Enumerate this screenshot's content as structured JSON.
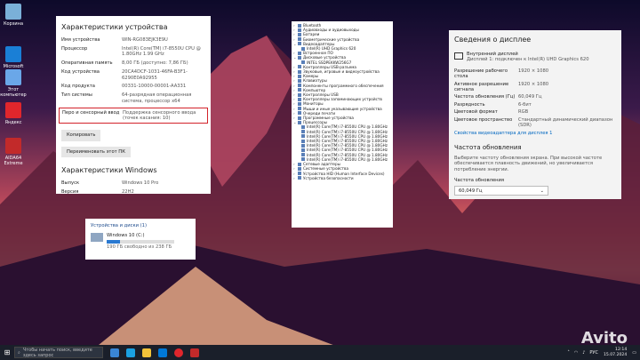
{
  "desktop": {
    "icons": [
      {
        "label": "Корзина",
        "color": "#7ab0d8"
      },
      {
        "label": "Microsoft Edge",
        "color": "#1a7fd6"
      },
      {
        "label": "Этот компьютер",
        "color": "#6aa7e8"
      },
      {
        "label": "Яндекс",
        "color": "#e0262c"
      },
      {
        "label": "AIDA64 Extreme",
        "color": "#c22a2a"
      }
    ]
  },
  "device_specs": {
    "title": "Характеристики устройства",
    "rows": [
      {
        "k": "Имя устройства",
        "v": "WIN-RG083EJK3E9U"
      },
      {
        "k": "Процессор",
        "v": "Intel(R) Core(TM) i7-8550U CPU @ 1.80GHz 1.99 GHz"
      },
      {
        "k": "Оперативная память",
        "v": "8,00 ГБ (доступно: 7,86 ГБ)"
      },
      {
        "k": "Код устройства",
        "v": "20CA4DCF-1031-46FA-B3F1-6290E0A92955"
      },
      {
        "k": "Код продукта",
        "v": "00331-10000-00001-AA331"
      },
      {
        "k": "Тип системы",
        "v": "64-разрядная операционная система, процессор x64"
      }
    ],
    "pen_row": {
      "k": "Перо и сенсорный ввод",
      "v": "Поддержка сенсорного ввода (точек касания: 10)"
    },
    "copy_button": "Копировать",
    "rename_button": "Переименовать этот ПК",
    "windows_title": "Характеристики Windows",
    "win_rows": [
      {
        "k": "Выпуск",
        "v": "Windows 10 Pro"
      },
      {
        "k": "Версия",
        "v": "22H2"
      }
    ]
  },
  "device_manager": {
    "items": [
      {
        "label": "Bluetooth",
        "level": 0,
        "arrow": "›"
      },
      {
        "label": "Аудиовходы и аудиовыходы",
        "level": 0,
        "arrow": "›"
      },
      {
        "label": "Батареи",
        "level": 0,
        "arrow": "›"
      },
      {
        "label": "Биометрические устройства",
        "level": 0,
        "arrow": "›"
      },
      {
        "label": "Видеоадаптеры",
        "level": 0,
        "arrow": "⌄"
      },
      {
        "label": "Intel(R) UHD Graphics 620",
        "level": 1,
        "arrow": ""
      },
      {
        "label": "Встроенное ПО",
        "level": 0,
        "arrow": "›"
      },
      {
        "label": "Дисковые устройства",
        "level": 0,
        "arrow": "⌄"
      },
      {
        "label": "INTEL SSDPEKKW256G7",
        "level": 1,
        "arrow": ""
      },
      {
        "label": "Контроллеры USB-разъема",
        "level": 0,
        "arrow": "›"
      },
      {
        "label": "Звуковые, игровые и видеоустройства",
        "level": 0,
        "arrow": "›"
      },
      {
        "label": "Камеры",
        "level": 0,
        "arrow": "›"
      },
      {
        "label": "Клавиатуры",
        "level": 0,
        "arrow": "›"
      },
      {
        "label": "Компоненты программного обеспечения",
        "level": 0,
        "arrow": "›"
      },
      {
        "label": "Компьютер",
        "level": 0,
        "arrow": "›"
      },
      {
        "label": "Контроллеры USB",
        "level": 0,
        "arrow": "›"
      },
      {
        "label": "Контроллеры запоминающих устройств",
        "level": 0,
        "arrow": "›"
      },
      {
        "label": "Мониторы",
        "level": 0,
        "arrow": "›"
      },
      {
        "label": "Мыши и иные указывающие устройства",
        "level": 0,
        "arrow": "›"
      },
      {
        "label": "Очереди печати",
        "level": 0,
        "arrow": "›"
      },
      {
        "label": "Программные устройства",
        "level": 0,
        "arrow": "›"
      },
      {
        "label": "Процессоры",
        "level": 0,
        "arrow": "⌄"
      },
      {
        "label": "Intel(R) Core(TM) i7-8550U CPU @ 1.80GHz",
        "level": 1,
        "arrow": ""
      },
      {
        "label": "Intel(R) Core(TM) i7-8550U CPU @ 1.80GHz",
        "level": 1,
        "arrow": ""
      },
      {
        "label": "Intel(R) Core(TM) i7-8550U CPU @ 1.80GHz",
        "level": 1,
        "arrow": ""
      },
      {
        "label": "Intel(R) Core(TM) i7-8550U CPU @ 1.80GHz",
        "level": 1,
        "arrow": ""
      },
      {
        "label": "Intel(R) Core(TM) i7-8550U CPU @ 1.80GHz",
        "level": 1,
        "arrow": ""
      },
      {
        "label": "Intel(R) Core(TM) i7-8550U CPU @ 1.80GHz",
        "level": 1,
        "arrow": ""
      },
      {
        "label": "Intel(R) Core(TM) i7-8550U CPU @ 1.80GHz",
        "level": 1,
        "arrow": ""
      },
      {
        "label": "Intel(R) Core(TM) i7-8550U CPU @ 1.80GHz",
        "level": 1,
        "arrow": ""
      },
      {
        "label": "Сетевые адаптеры",
        "level": 0,
        "arrow": "›"
      },
      {
        "label": "Системные устройства",
        "level": 0,
        "arrow": "›"
      },
      {
        "label": "Устройства HID (Human Interface Devices)",
        "level": 0,
        "arrow": "›"
      },
      {
        "label": "Устройства безопасности",
        "level": 0,
        "arrow": "›"
      }
    ]
  },
  "display_info": {
    "title": "Сведения о дисплее",
    "monitor_name": "Внутренний дисплей",
    "monitor_sub": "Дисплей 1: подключен к Intel(R) UHD Graphics 620",
    "rows": [
      {
        "k": "Разрешение рабочего стола",
        "v": "1920 × 1080"
      },
      {
        "k": "Активное разрешение сигнала",
        "v": "1920 × 1080"
      },
      {
        "k": "Частота обновления (Гц)",
        "v": "60,049 Гц"
      },
      {
        "k": "Разрядность",
        "v": "6-бит"
      },
      {
        "k": "Цветовой формат",
        "v": "RGB"
      },
      {
        "k": "Цветовое пространство",
        "v": "Стандартный динамический диапазон (SDR)"
      }
    ],
    "link": "Свойства видеоадаптера для дисплея 1",
    "refresh_title": "Частота обновления",
    "refresh_desc": "Выберите частоту обновления экрана. При высокой частоте обеспечивается плавность движений, но увеличивается потребление энергии.",
    "refresh_label": "Частота обновления",
    "refresh_value": "60,049 Гц"
  },
  "explorer_drive": {
    "header": "Устройства и диски (1)",
    "name": "Windows 10 (C:)",
    "free": "190 ГБ свободно из 238 ГБ",
    "used_fraction": 0.2
  },
  "taskbar": {
    "search_placeholder": "Чтобы начать поиск, введите здесь запрос",
    "lang": "РУС",
    "time": "12:14",
    "date": "15.07.2024"
  },
  "watermark": "Avito"
}
